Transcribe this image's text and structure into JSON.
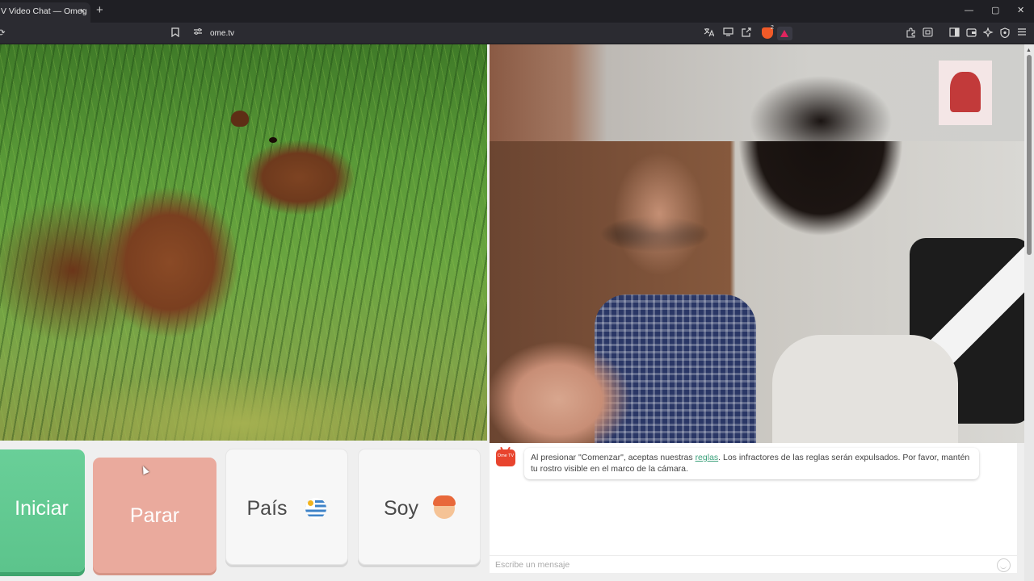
{
  "browser": {
    "tab_title": "V Video Chat — Omeg",
    "tab_close": "×",
    "new_tab": "+",
    "url": "ome.tv",
    "shields_count": "2",
    "window_controls": {
      "minimize": "—",
      "maximize": "▢",
      "close": "✕"
    },
    "icons": [
      "bookmark-icon",
      "site-info-icon",
      "translate-icon",
      "cast-icon",
      "share-icon",
      "brave-shields-icon",
      "brave-rewards-icon",
      "extensions-icon",
      "screenshot-icon",
      "sidebar-icon",
      "wallet-icon",
      "leo-ai-icon",
      "vpn-icon",
      "menu-icon"
    ]
  },
  "controls": {
    "start_label": "Iniciar",
    "stop_label": "Parar",
    "country_label": "País",
    "country_flag": "uruguay-flag-icon",
    "me_label": "Soy",
    "me_emoji": "boy-face-icon",
    "colors": {
      "start": "#5cc48c",
      "stop": "#eaaa9d",
      "neutral": "#f7f7f7"
    }
  },
  "chat": {
    "logo_text": "Ome TV",
    "notice_before_link": "Al presionar \"Comenzar\", aceptas nuestras ",
    "rules_link": "reglas",
    "notice_after_link": ". Los infractores de las reglas serán expulsados. Por favor, mantén tu rostro visible en el marco de la cámara.",
    "input_placeholder": "Escribe un mensaje",
    "input_value": ""
  },
  "video": {
    "own_feed": "capybara-in-grass-image",
    "stranger_feed": "remote-webcam-image"
  }
}
